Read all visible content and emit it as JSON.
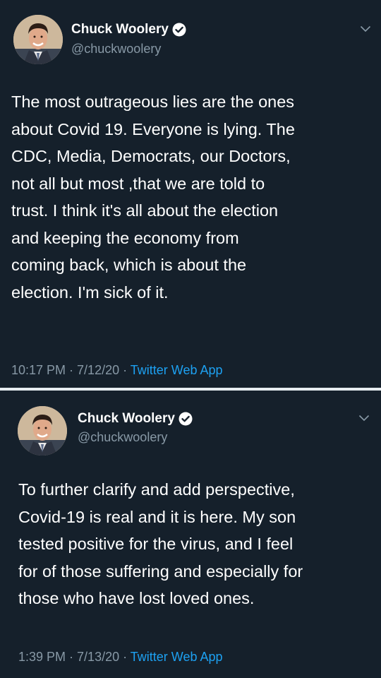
{
  "tweets": [
    {
      "author": {
        "display_name": "Chuck Woolery",
        "handle": "@chuckwoolery",
        "verified": true,
        "avatar_icon": "profile-photo"
      },
      "text_lines": [
        "The most outrageous lies are the ones",
        "about Covid 19. Everyone is lying. The",
        "CDC, Media, Democrats, our Doctors,",
        "not all but most ,that we are told to",
        "trust. I think it's all about the election",
        "and keeping the economy from",
        "coming back, which is about the",
        "election. I'm sick of it."
      ],
      "time": "10:17 PM",
      "date": "7/12/20",
      "source": "Twitter Web App",
      "separator": " · "
    },
    {
      "author": {
        "display_name": "Chuck Woolery",
        "handle": "@chuckwoolery",
        "verified": true,
        "avatar_icon": "profile-photo"
      },
      "text_lines": [
        "To further clarify and add perspective,",
        "Covid-19 is real and it is here. My son",
        "tested positive for the virus, and I feel",
        "for of those suffering and especially for",
        "those who have lost loved ones."
      ],
      "time": "1:39 PM",
      "date": "7/13/20",
      "source": "Twitter Web App",
      "separator": " · "
    }
  ],
  "colors": {
    "background": "#15202b",
    "text_primary": "#ffffff",
    "text_secondary": "#8899a6",
    "accent": "#1da1f2",
    "separator": "#e6ecf0"
  },
  "icons": {
    "verified": "verified-badge-icon",
    "menu": "chevron-down-icon"
  }
}
